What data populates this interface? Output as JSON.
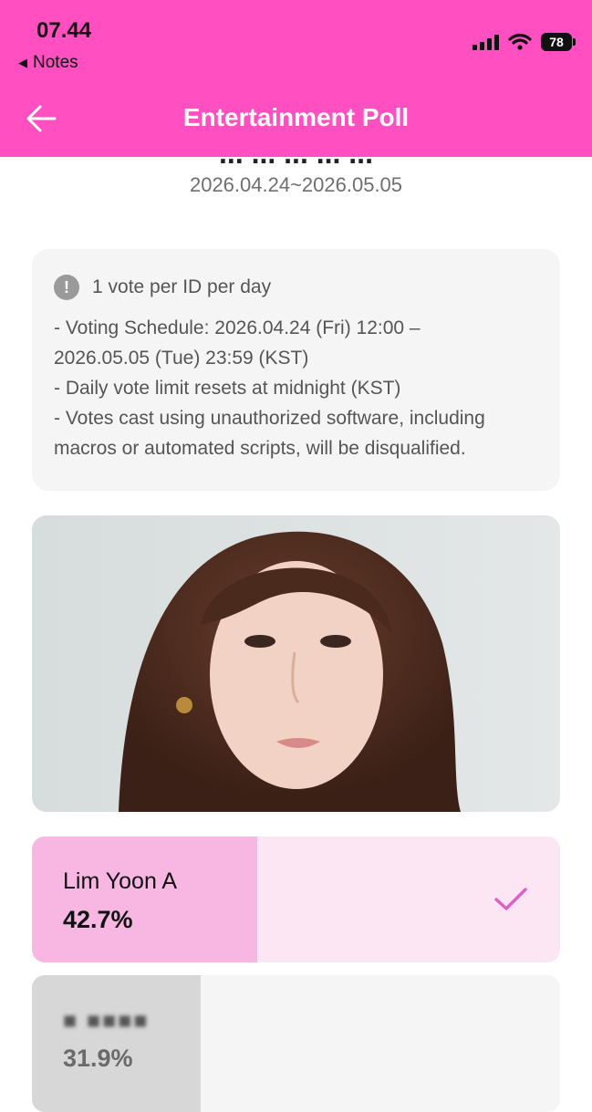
{
  "status": {
    "time": "07.44",
    "back_label": "Notes",
    "battery": "78"
  },
  "nav": {
    "title": "Entertainment Poll"
  },
  "poll": {
    "title_cut": "... ... ... ... ...",
    "date_range": "2026.04.24~2026.05.05"
  },
  "notice": {
    "title": "1 vote per ID per day",
    "lines": [
      "- Voting Schedule: 2026.04.24 (Fri) 12:00 –",
      "2026.05.05 (Tue) 23:59 (KST)",
      "- Daily vote limit resets at midnight (KST)",
      "- Votes cast using unauthorized software, including",
      "macros or automated scripts, will be disqualified."
    ]
  },
  "options": [
    {
      "name": "Lim Yoon A",
      "percent": "42.7%",
      "share": 0.427,
      "selected": true
    },
    {
      "name": "■ ■■■■",
      "percent": "31.9%",
      "share": 0.319,
      "selected": false
    }
  ],
  "colors": {
    "header": "#ff4fc1",
    "selected_bg": "#fce6f4",
    "selected_fill": "#f8b7e3",
    "check": "#e05fc4"
  }
}
